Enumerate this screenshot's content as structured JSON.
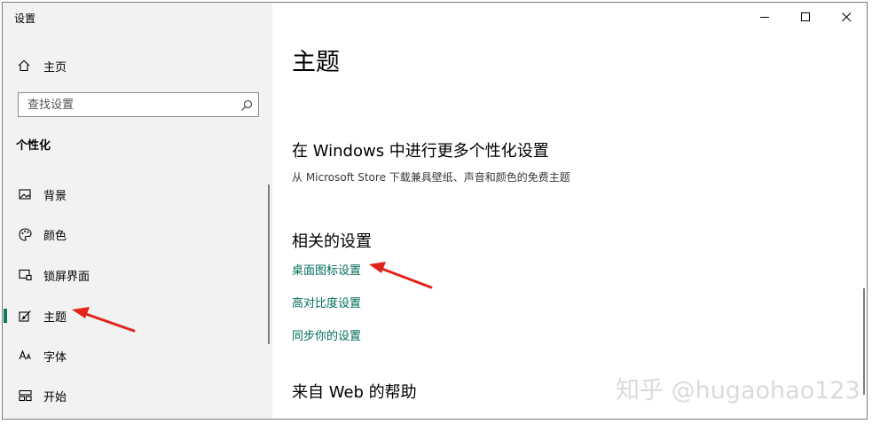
{
  "window": {
    "title": "设置"
  },
  "sidebar": {
    "home_label": "主页",
    "search_placeholder": "查找设置",
    "section_heading": "个性化",
    "items": [
      {
        "label": "背景",
        "icon": "image-icon"
      },
      {
        "label": "颜色",
        "icon": "palette-icon"
      },
      {
        "label": "锁屏界面",
        "icon": "lock-screen-icon"
      },
      {
        "label": "主题",
        "icon": "theme-icon",
        "active": true
      },
      {
        "label": "字体",
        "icon": "font-icon"
      },
      {
        "label": "开始",
        "icon": "start-icon"
      }
    ]
  },
  "main": {
    "title": "主题",
    "windows_section": {
      "heading": "在 Windows 中进行更多个性化设置",
      "description": "从 Microsoft Store 下载兼具壁纸、声音和颜色的免费主题"
    },
    "related_settings": {
      "heading": "相关的设置",
      "links": [
        "桌面图标设置",
        "高对比度设置",
        "同步你的设置"
      ]
    },
    "help_heading": "来自 Web 的帮助"
  },
  "watermark": "知乎 @hugaohao123",
  "colors": {
    "accent": "#0b7a5e",
    "link": "#006d5b",
    "annotation_arrow": "#e2231a",
    "sidebar_bg": "#f2f2f2"
  }
}
